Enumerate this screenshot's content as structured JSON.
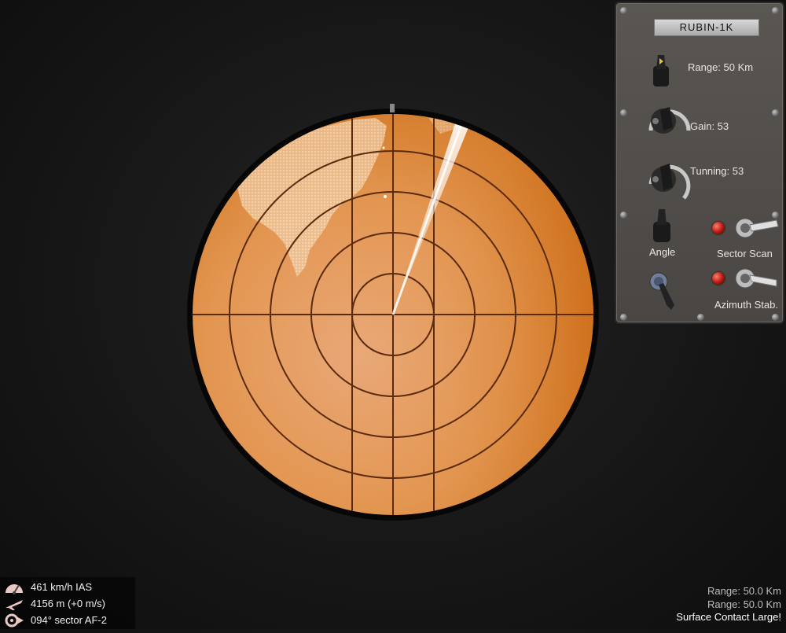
{
  "panel": {
    "title": "RUBIN-1K",
    "range_label": "Range: 50 Km",
    "gain_label": "Gain: 53",
    "tuning_label": "Tunning: 53",
    "angle_label": "Angle",
    "sector_scan_label": "Sector Scan",
    "azimuth_stab_label": "Azimuth Stab."
  },
  "hud": {
    "speed": "461 km/h IAS",
    "altitude": "4156 m (+0 m/s)",
    "heading": "094° sector AF-2"
  },
  "status": {
    "range_line1": "Range: 50.0 Km",
    "range_line2": "Range: 50.0 Km",
    "message": "Surface Contact Large!"
  },
  "colors": {
    "scope_light": "#e9a86a",
    "scope_dark": "#cf6c14",
    "grid": "#5a2a0c",
    "message": "#ffffff"
  },
  "icons": {
    "speed": "speedometer-icon",
    "altitude": "aircraft-climb-icon",
    "heading": "compass-icon"
  },
  "radar": {
    "sweep_angle_deg": 22,
    "ring_count": 5
  }
}
